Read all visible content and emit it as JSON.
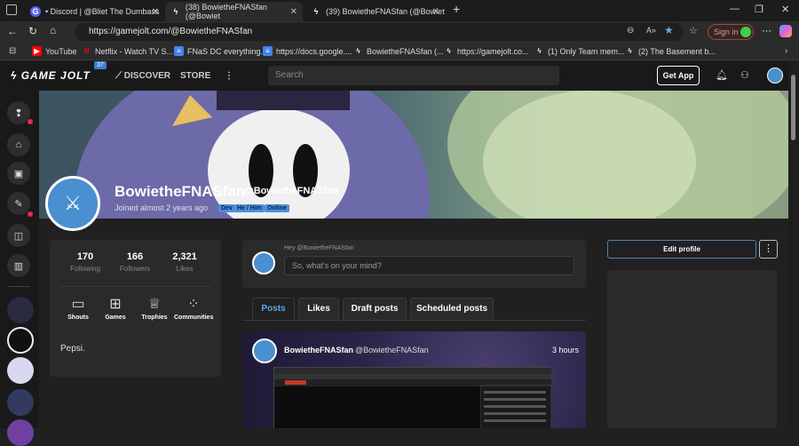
{
  "browser": {
    "tabs": [
      {
        "title": "• Discord | @Bliet The Dumbass",
        "icon": "discord-icon",
        "active": false
      },
      {
        "title": "(38) BowietheFNASfan (@Bowiet",
        "icon": "gamejolt-icon",
        "active": true
      },
      {
        "title": "(39) BowietheFNASfan (@Bowiet",
        "icon": "gamejolt-icon",
        "active": false
      }
    ],
    "new_tab": "+",
    "url": "https://gamejolt.com/@BowietheFNASfan",
    "sign_in": "Sign in",
    "bookmarks": [
      {
        "label": "YouTube",
        "icon": "youtube-icon"
      },
      {
        "label": "Netflix - Watch TV S...",
        "icon": "netflix-icon"
      },
      {
        "label": "FNaS DC everything...",
        "icon": "docs-icon"
      },
      {
        "label": "https://docs.google....",
        "icon": "docs-icon"
      },
      {
        "label": "BowietheFNASfan (...",
        "icon": "gamejolt-icon"
      },
      {
        "label": "https://gamejolt.co...",
        "icon": "gamejolt-icon"
      },
      {
        "label": "(1) Only Team mem...",
        "icon": "gamejolt-icon"
      },
      {
        "label": "(2) The Basement b...",
        "icon": "gamejolt-icon"
      }
    ]
  },
  "gj_nav": {
    "logo": "GAME JOLT",
    "level_badge": "37",
    "discover": "DISCOVER",
    "store": "STORE",
    "search_placeholder": "Search",
    "get_app": "Get App"
  },
  "profile": {
    "display_name": "BowietheFNASfan",
    "username": "@BowietheFNASfan",
    "joined": "Joined almost 2 years ago",
    "tags": [
      "Dev",
      "He / Him",
      "Online"
    ],
    "stats": [
      {
        "value": "170",
        "label": "Following"
      },
      {
        "value": "166",
        "label": "Followers"
      },
      {
        "value": "2,321",
        "label": "Likes"
      }
    ],
    "quick_links": [
      {
        "label": "Shouts",
        "icon": "shouts-icon"
      },
      {
        "label": "Games",
        "icon": "gamepad-icon"
      },
      {
        "label": "Trophies",
        "icon": "trophy-icon"
      },
      {
        "label": "Communities",
        "icon": "communities-icon"
      }
    ],
    "bio": "Pepsi."
  },
  "post_box": {
    "hey": "Hey @BowietheFNASfan",
    "placeholder": "So, what's on your mind?"
  },
  "post_tabs": [
    "Posts",
    "Likes",
    "Draft posts",
    "Scheduled posts"
  ],
  "post": {
    "author": "BowietheFNASfan",
    "username": "@BowietheFNASfan",
    "time": "3 hours"
  },
  "right": {
    "edit_profile": "Edit profile"
  },
  "colors": {
    "accent": "#5da8e8",
    "tag_bg": "#4a90d9",
    "notify": "#e03050"
  }
}
